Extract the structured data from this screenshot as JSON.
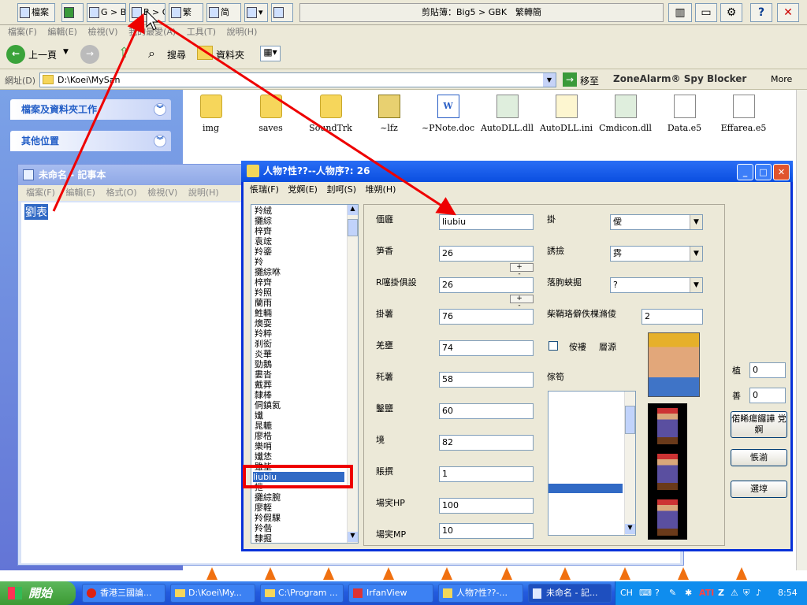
{
  "clipboard_toolbar": {
    "buttons": [
      {
        "label": "檔案"
      },
      {
        "label": ""
      },
      {
        "label": "G > B"
      },
      {
        "label": "B > G"
      },
      {
        "label": "繁"
      },
      {
        "label": "简"
      },
      {
        "label": ""
      },
      {
        "label": ""
      }
    ],
    "title": "剪貼簿：Big5 > GBK　繁轉簡",
    "right_buttons": [
      "",
      "",
      "",
      "?",
      "✕"
    ]
  },
  "explorer": {
    "menu": [
      "檔案(F)",
      "編輯(E)",
      "檢視(V)",
      "我的最愛(A)",
      "工具(T)",
      "說明(H)"
    ],
    "back_label": "上一頁",
    "search_label": "搜尋",
    "folders_label": "資料夾",
    "address_label": "網址(D)",
    "address_value": "D:\\Koei\\MySan",
    "go_label": "移至",
    "zonealarm": "ZoneAlarm® Spy Blocker",
    "more_label": "More",
    "task_panels": [
      "檔案及資料夾工作",
      "其他位置"
    ],
    "files": [
      {
        "name": "img",
        "icon": "folder-icon"
      },
      {
        "name": "saves",
        "icon": "folder-icon"
      },
      {
        "name": "SoundTrk",
        "icon": "folder-icon"
      },
      {
        "name": "~lfz",
        "icon": "wing-icon"
      },
      {
        "name": "~PNote.doc",
        "icon": "word-doc-icon"
      },
      {
        "name": "AutoDLL.dll",
        "icon": "dll-icon"
      },
      {
        "name": "AutoDLL.ini",
        "icon": "ini-icon"
      },
      {
        "name": "Cmdicon.dll",
        "icon": "dll-icon"
      },
      {
        "name": "Data.e5",
        "icon": "data-file-icon"
      },
      {
        "name": "Effarea.e5",
        "icon": "data-file-icon"
      }
    ]
  },
  "notepad": {
    "title": "未命名 - 記事本",
    "menu": [
      "檔案(F)",
      "編輯(E)",
      "格式(O)",
      "檢視(V)",
      "說明(H)"
    ],
    "selected_text": "劉表"
  },
  "editor": {
    "title": "人物?性??--人物序?: 26",
    "menu": [
      "悵瑞(F)",
      "党婀(E)",
      "刲呵(S)",
      "堆朔(H)"
    ],
    "names": [
      "羚絨",
      "攤綜",
      "梓齊",
      "袁竤",
      "羚鎏",
      "羚",
      "攤綜咻",
      "梓齊",
      "羚照",
      "蘭雨",
      "鮏輛",
      "燠耍",
      "羚粹",
      "刹衒",
      "炎華",
      "勁鵝",
      "婁沓",
      "戴葬",
      "隸棒",
      "侗鎮氦",
      "孅",
      "晁轆",
      "廖梏",
      "樂哨",
      "孅恷",
      "雖坒",
      "liubiu",
      "抴",
      "攤綜腕",
      "廖輊",
      "羚假騍",
      "羚偕",
      "隸掘"
    ],
    "selected_name": "liubiu",
    "fields": {
      "name_label": "偭廱",
      "name_value": "liubiu",
      "f2_label": "笋香",
      "f2_value": "26",
      "f3_label": "R噻掛俱設",
      "f3_value": "26",
      "f4_label": "掛薯",
      "f4_value": "76",
      "f5_label": "羌壅",
      "f5_value": "74",
      "f6_label": "秅薯",
      "f6_value": "58",
      "f7_label": "鑿鹽",
      "f7_value": "60",
      "f8_label": "境",
      "f8_value": "82",
      "f9_label": "賬撰",
      "f9_value": "1",
      "hp_label": "場宎HP",
      "hp_value": "100",
      "mp_label": "場宎MP",
      "mp_value": "10"
    },
    "spin_label": "+ -",
    "right": {
      "c1_label": "掛",
      "c1_value": "僾",
      "c2_label": "誘撿",
      "c2_value": "霠",
      "c3_label": "落朐蛺掘",
      "c3_value": "?",
      "c4_label": "柴鞘珞僻佚棵滫倰",
      "c4_value": "2",
      "check1": "侒褸",
      "check2": "層源",
      "items_label": "傢笱"
    },
    "far_right": {
      "v1_label": "植",
      "v1_value": "0",
      "v2_label": "善",
      "v2_value": "0",
      "btn1": "偌睎瘍饠譁 党婀",
      "btn2": "悵湔",
      "btn3": "選埻"
    }
  },
  "taskbar": {
    "start": "開始",
    "tasks": [
      {
        "label": "香港三國論...",
        "icon": "opera-icon"
      },
      {
        "label": "D:\\Koei\\My...",
        "icon": "folder-icon"
      },
      {
        "label": "C:\\Program ...",
        "icon": "folder-icon"
      },
      {
        "label": "IrfanView",
        "icon": "irfanview-icon"
      },
      {
        "label": "人物?性??-...",
        "icon": "wing-icon"
      },
      {
        "label": "未命名 - 記...",
        "icon": "notepad-icon"
      }
    ],
    "lang": "CH",
    "clock": "8:54"
  }
}
